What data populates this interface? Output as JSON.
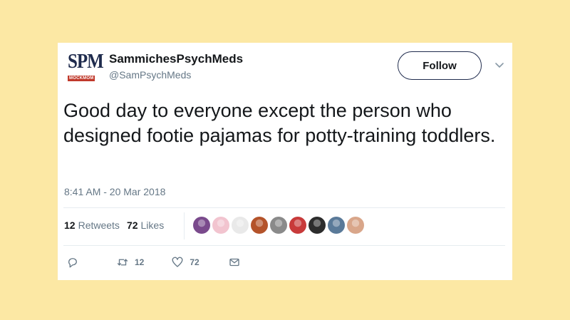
{
  "account": {
    "logo_main": "SPM",
    "logo_sub": "MOCKMOM",
    "display_name": "SammichesPsychMeds",
    "handle": "@SamPsychMeds"
  },
  "follow": {
    "label": "Follow"
  },
  "tweet": {
    "text": "Good day to everyone except the person who designed footie pajamas for potty-training toddlers.",
    "timestamp": "8:41 AM - 20 Mar 2018"
  },
  "stats": {
    "retweets_count": "12",
    "retweets_label": "Retweets",
    "likes_count": "72",
    "likes_label": "Likes"
  },
  "likers": [
    {
      "icon": "liker-avatar",
      "color": "#7a4a8c"
    },
    {
      "icon": "liker-avatar",
      "color": "#f2c4cf"
    },
    {
      "icon": "liker-avatar",
      "color": "#e9e9e9"
    },
    {
      "icon": "liker-avatar",
      "color": "#b4532a"
    },
    {
      "icon": "liker-avatar",
      "color": "#8a8a8a"
    },
    {
      "icon": "liker-avatar",
      "color": "#c83a3a"
    },
    {
      "icon": "liker-avatar",
      "color": "#2c2c2c"
    },
    {
      "icon": "liker-avatar",
      "color": "#5a7a99"
    },
    {
      "icon": "liker-avatar",
      "color": "#d9a68a"
    }
  ],
  "actions": {
    "reply_icon": "reply-icon",
    "retweet_icon": "retweet-icon",
    "retweet_count": "12",
    "like_icon": "heart-icon",
    "like_count": "72",
    "dm_icon": "envelope-icon"
  },
  "colors": {
    "background": "#fce8a4",
    "text_primary": "#14171a",
    "text_secondary": "#657786"
  }
}
